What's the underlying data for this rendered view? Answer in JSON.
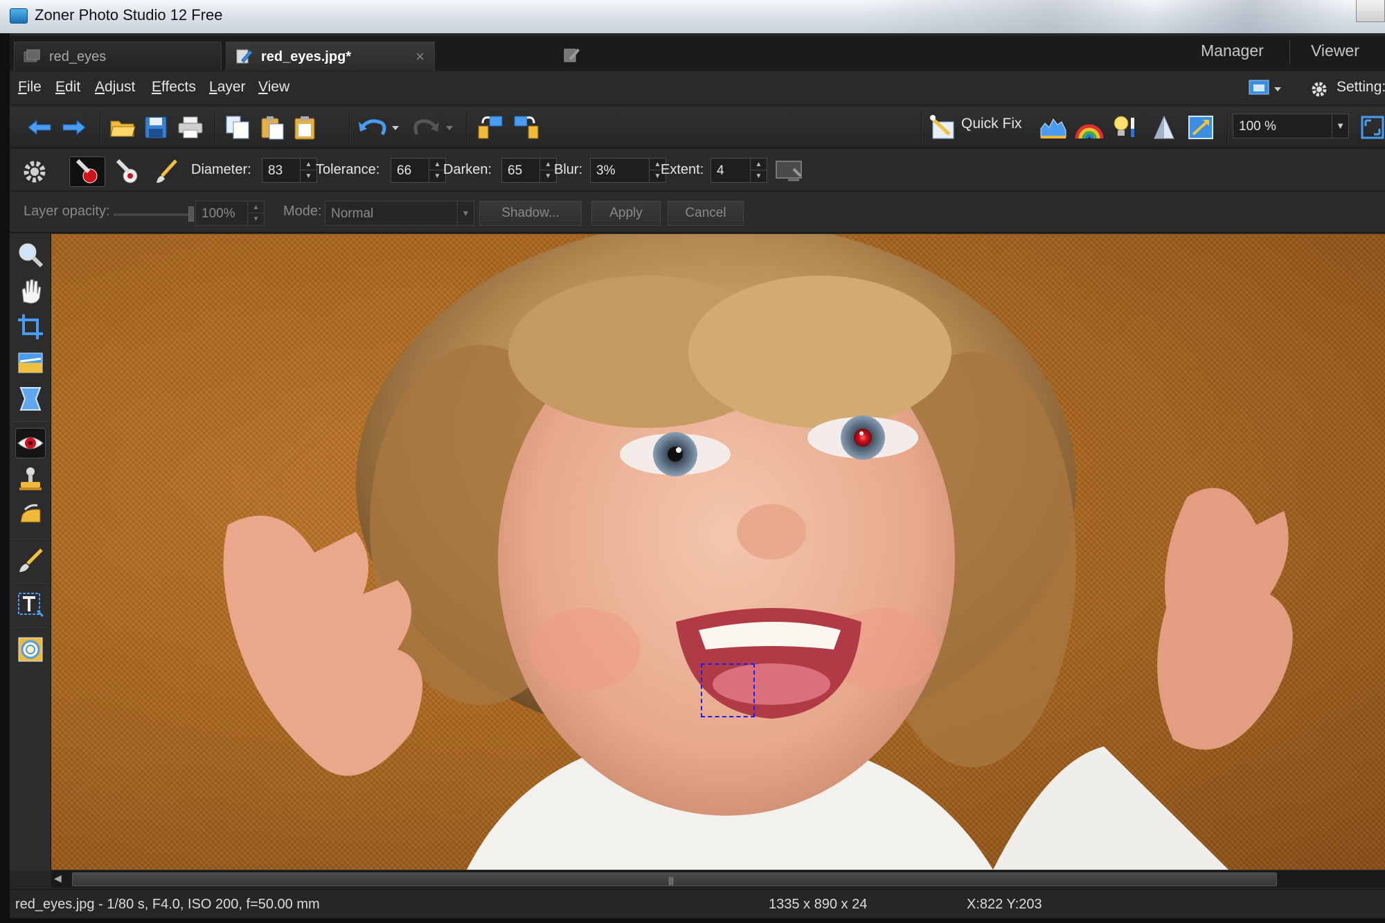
{
  "window": {
    "title": "Zoner Photo Studio 12 Free"
  },
  "tabs": [
    {
      "label": "red_eyes",
      "active": false
    },
    {
      "label": "red_eyes.jpg*",
      "active": true,
      "close": "×"
    }
  ],
  "modes": {
    "manager": "Manager",
    "viewer": "Viewer"
  },
  "menu": {
    "file": {
      "u": "F",
      "rest": "ile"
    },
    "edit": {
      "u": "E",
      "rest": "dit"
    },
    "adjust": {
      "u": "A",
      "rest": "djust"
    },
    "effects": {
      "u": "E",
      "rest": "ffects"
    },
    "layer": {
      "u": "L",
      "rest": "ayer"
    },
    "view": {
      "u": "V",
      "rest": "iew"
    },
    "settings": "Setting:"
  },
  "toolbar": {
    "quick_fix": "Quick Fix",
    "zoom": "100 %"
  },
  "options": {
    "diameter": {
      "label": "Diameter:",
      "value": "83"
    },
    "tolerance": {
      "label": "Tolerance:",
      "value": "66"
    },
    "darken": {
      "label": "Darken:",
      "value": "65"
    },
    "blur": {
      "label": "Blur:",
      "value": "3%"
    },
    "extent": {
      "label": "Extent:",
      "value": "4"
    }
  },
  "layer": {
    "opacity_label": "Layer opacity:",
    "opacity_value": "100%",
    "mode_label": "Mode:",
    "mode_value": "Normal",
    "shadow": "Shadow...",
    "apply": "Apply",
    "cancel": "Cancel"
  },
  "status": {
    "file_info": "red_eyes.jpg - 1/80 s, F4.0, ISO 200, f=50.00 mm",
    "dimensions": "1335 x 890 x 24",
    "coords": "X:822  Y:203"
  },
  "icons": {
    "back": "arrow-left-icon",
    "forward": "arrow-right-icon",
    "open": "folder-icon",
    "save": "save-icon",
    "print": "print-icon",
    "copy": "copy-icon",
    "paste": "paste-icon",
    "undo": "undo-icon",
    "redo": "redo-icon",
    "zoom_tool": "magnifier-icon",
    "hand": "hand-icon",
    "crop": "crop-icon",
    "red_eye": "eye-icon",
    "text": "text-tool-icon"
  },
  "colors": {
    "accent": "#3b8fe0",
    "selection": "#1a1aff",
    "red_eye": "#d0101a"
  }
}
